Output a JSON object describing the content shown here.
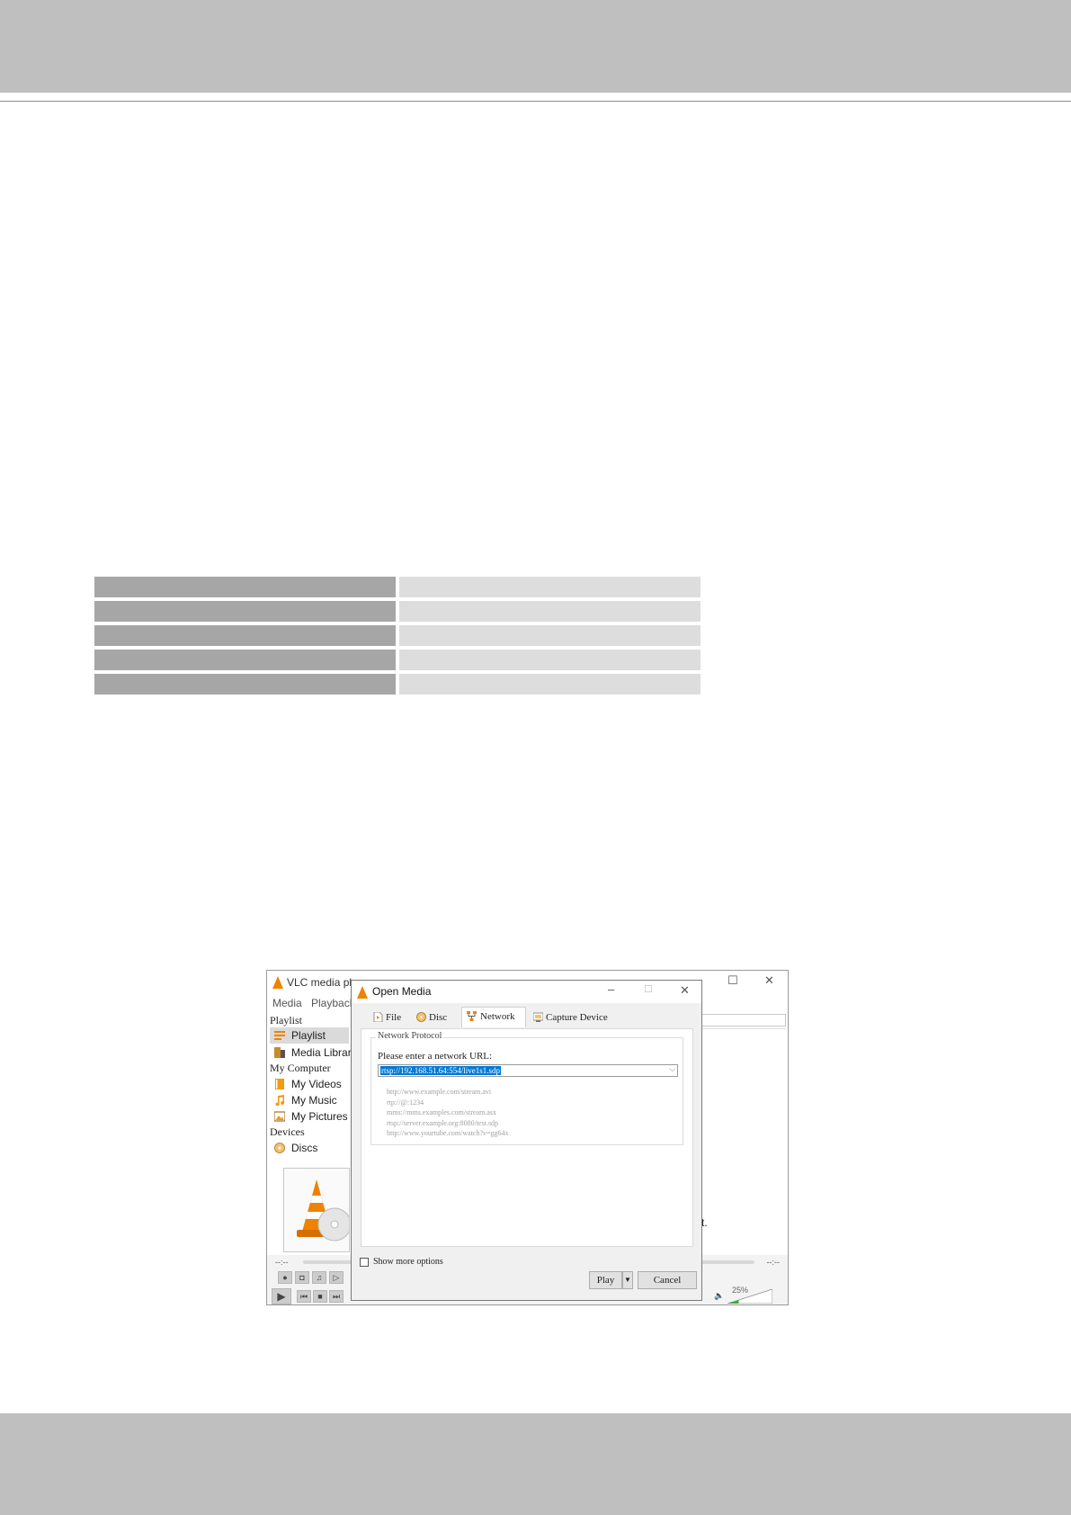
{
  "vlc": {
    "title": "VLC media pl",
    "menu": [
      "Media",
      "Playback"
    ],
    "sidebar": {
      "playlist_header": "Playlist",
      "playlist_items": [
        "Playlist",
        "Media Library"
      ],
      "computer_header": "My Computer",
      "computer_items": [
        "My Videos",
        "My Music",
        "My Pictures"
      ],
      "devices_header": "Devices",
      "device_items": [
        "Discs"
      ]
    },
    "time_elapsed": "--:--",
    "time_total": "--:--",
    "volume": "25%",
    "volume_level": 0.25,
    "right_fragment": "t."
  },
  "dialog": {
    "title": "Open Media",
    "tabs": [
      "File",
      "Disc",
      "Network",
      "Capture Device"
    ],
    "active_tab": "Network",
    "group_label": "Network Protocol",
    "url_label": "Please enter a network URL:",
    "url_value": "rtsp://192.168.51.64:554/live1s1.sdp",
    "examples": [
      "http://www.example.com/stream.avi",
      "rtp://@:1234",
      "mms://mms.examples.com/stream.asx",
      "rtsp://server.example.org:8080/test.sdp",
      "http://www.yourtube.com/watch?v=gg64x"
    ],
    "show_more": "Show more options",
    "play_label": "Play",
    "cancel_label": "Cancel"
  },
  "colors": {
    "vlc_orange": "#ef8200",
    "selection_blue": "#0078d7",
    "volume_green": "#35b233"
  }
}
